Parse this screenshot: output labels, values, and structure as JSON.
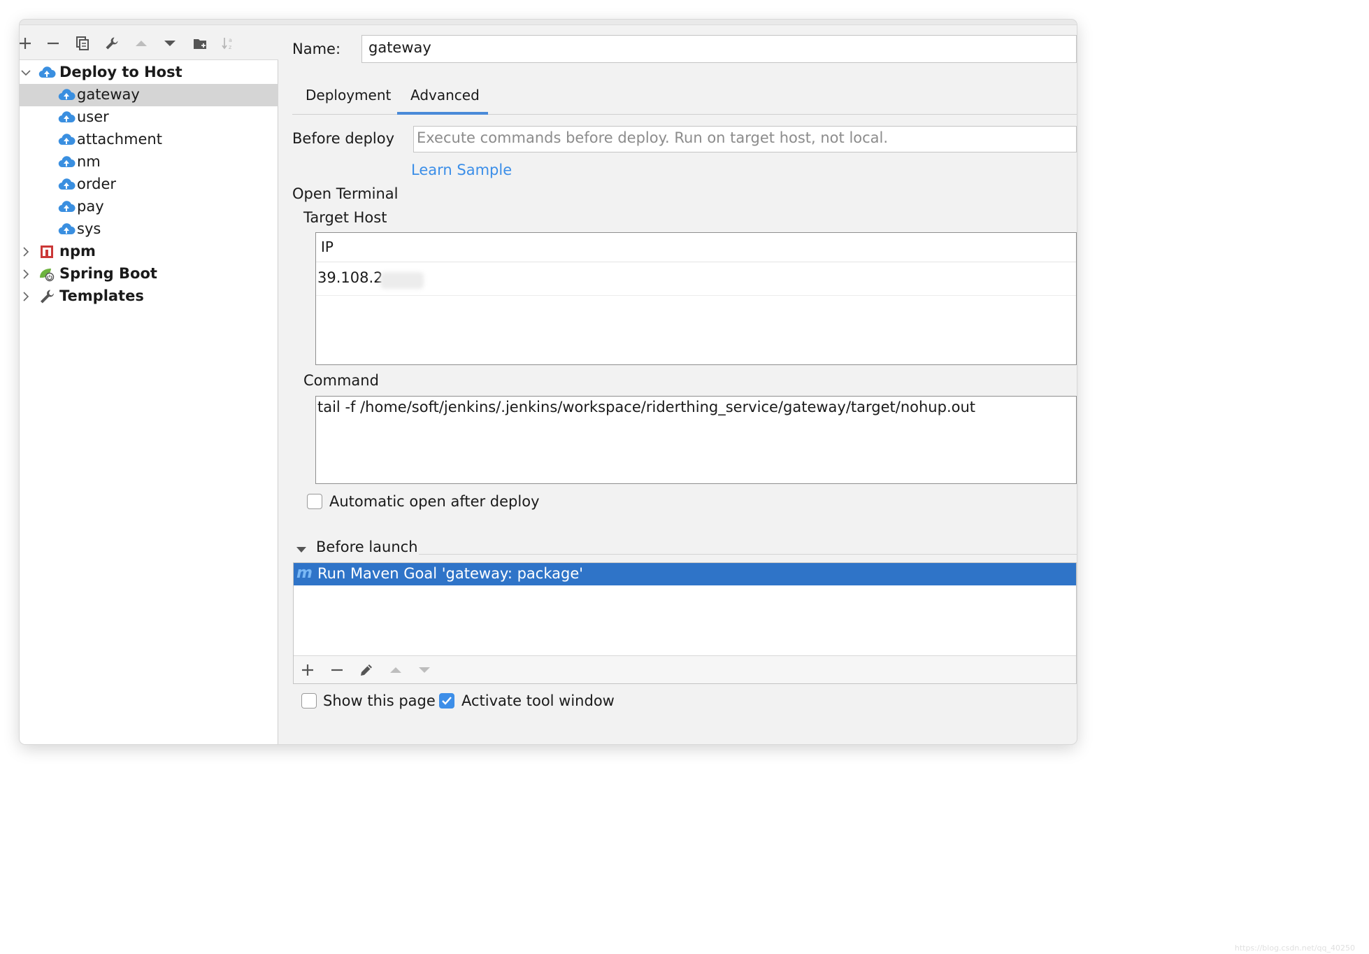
{
  "tree": {
    "root": {
      "label": "Deploy to Host",
      "expanded": true
    },
    "items": [
      {
        "label": "gateway",
        "selected": true
      },
      {
        "label": "user"
      },
      {
        "label": "attachment"
      },
      {
        "label": "nm"
      },
      {
        "label": "order"
      },
      {
        "label": "pay"
      },
      {
        "label": "sys"
      }
    ],
    "groups": [
      {
        "label": "npm"
      },
      {
        "label": "Spring Boot"
      },
      {
        "label": "Templates"
      }
    ]
  },
  "form": {
    "name_label": "Name:",
    "name_value": "gateway",
    "tabs": [
      {
        "label": "Deployment"
      },
      {
        "label": "Advanced",
        "active": true
      }
    ],
    "before_deploy_label": "Before deploy",
    "before_deploy_placeholder": "Execute commands before deploy. Run on target host, not local.",
    "learn_sample": "Learn Sample",
    "open_terminal_label": "Open Terminal",
    "target_host_label": "Target Host",
    "table_header": "IP",
    "table_row_ip": "39.108.2",
    "command_label": "Command",
    "command_value": "tail -f /home/soft/jenkins/.jenkins/workspace/riderthing_service/gateway/target/nohup.out",
    "auto_open_label": "Automatic open after deploy",
    "auto_open_checked": false,
    "before_launch_label": "Before launch",
    "before_launch_items": [
      {
        "label": "Run Maven Goal 'gateway: package'"
      }
    ],
    "show_page_label": "Show this page",
    "show_page_checked": false,
    "activate_window_label": "Activate tool window",
    "activate_window_checked": true
  },
  "watermark": "https://blog.csdn.net/qq_40250",
  "colors": {
    "accent": "#3d8ee8",
    "selection": "#2f74c8",
    "link": "#3b8ee8",
    "tree_selected": "#d5d5d5"
  }
}
